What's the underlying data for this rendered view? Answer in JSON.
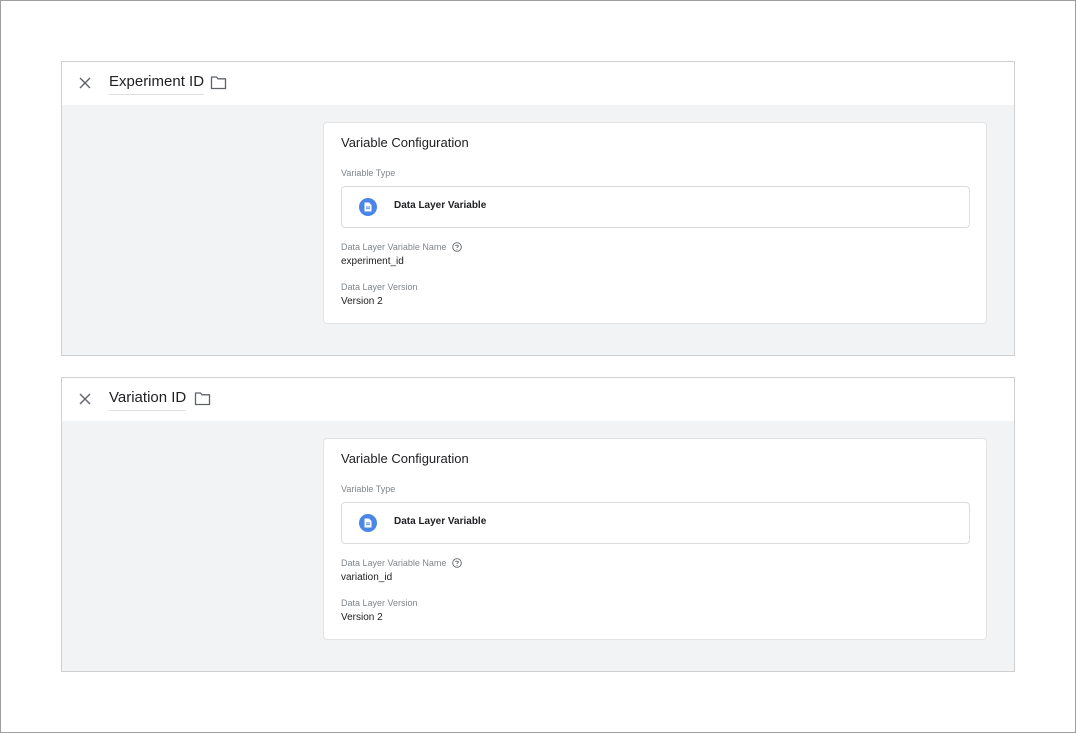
{
  "variables": [
    {
      "title": "Experiment ID",
      "config": {
        "heading": "Variable Configuration",
        "type_label": "Variable Type",
        "type_name": "Data Layer Variable",
        "name_label": "Data Layer Variable Name",
        "name_value": "experiment_id",
        "version_label": "Data Layer Version",
        "version_value": "Version 2"
      }
    },
    {
      "title": "Variation ID",
      "config": {
        "heading": "Variable Configuration",
        "type_label": "Variable Type",
        "type_name": "Data Layer Variable",
        "name_label": "Data Layer Variable Name",
        "name_value": "variation_id",
        "version_label": "Data Layer Version",
        "version_value": "Version 2"
      }
    }
  ],
  "icons": {
    "close": "close-icon",
    "folder": "folder-icon",
    "type": "data-layer-variable-icon",
    "help": "help-circle-icon"
  },
  "colors": {
    "type_icon_bg": "#4a86e8",
    "panel_bg": "#f1f3f4"
  }
}
